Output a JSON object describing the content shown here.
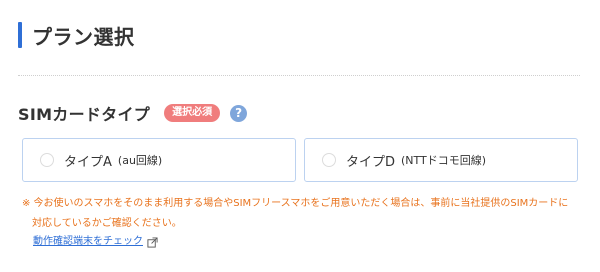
{
  "header": {
    "title": "プラン選択"
  },
  "sim_section": {
    "label": "SIMカードタイプ",
    "required_badge": "選択必須",
    "help_icon_glyph": "?",
    "options": [
      {
        "main": "タイプA",
        "sub": "(au回線)",
        "selected": false
      },
      {
        "main": "タイプD",
        "sub": "(NTTドコモ回線)",
        "selected": false
      }
    ]
  },
  "note": {
    "line1": "※ 今お使いのスマホをそのまま利用する場合やSIMフリースマホをご用意いただく場合は、事前に当社提供のSIMカードに",
    "line2": "対応しているかご確認ください。"
  },
  "link": {
    "label": "動作確認端末をチェック"
  },
  "colors": {
    "accent": "#2f6fd6",
    "badge": "#f07d7d",
    "note": "#e8731e",
    "help_icon": "#7fa6db",
    "card_border": "#bcd2f0"
  }
}
